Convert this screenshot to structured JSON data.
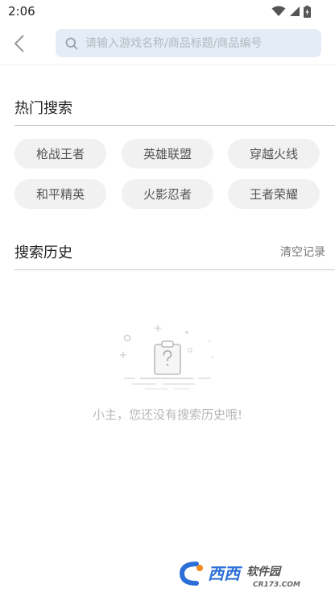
{
  "status_bar": {
    "time": "2:06"
  },
  "search": {
    "placeholder": "请输入游戏名称/商品标题/商品编号",
    "value": ""
  },
  "hot_search": {
    "title": "热门搜索",
    "tags": [
      "枪战王者",
      "英雄联盟",
      "穿越火线",
      "和平精英",
      "火影忍者",
      "王者荣耀"
    ]
  },
  "history": {
    "title": "搜索历史",
    "clear_label": "清空记录",
    "empty_message": "小主，您还没有搜索历史哦!"
  },
  "watermark": {
    "brand": "西西软件园",
    "domain": "CR173.COM"
  },
  "colors": {
    "search_bg": "#e4edf6",
    "tag_bg": "#f1f1f1",
    "watermark_accent": "#2d6fd8"
  }
}
